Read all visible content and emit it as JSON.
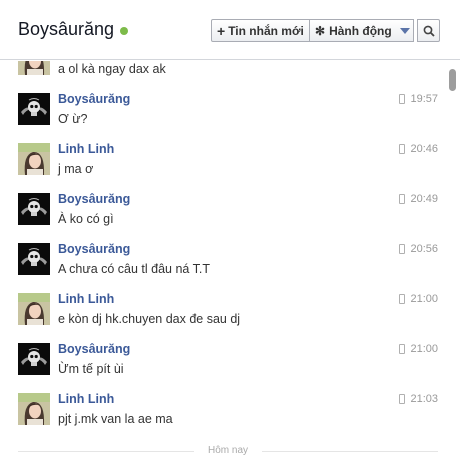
{
  "header": {
    "title": "Boysâurăng",
    "online_color": "#7dbb4a",
    "new_message_label": "Tin nhắn mới",
    "actions_label": "Hành động",
    "search_icon": "search-icon"
  },
  "messages": [
    {
      "sender": "",
      "text": "a ol kà ngay dax ak",
      "time": "",
      "avatar": "girl"
    },
    {
      "sender": "Boysâurăng",
      "text": "Ơ ừ?",
      "time": "19:57",
      "avatar": "skull"
    },
    {
      "sender": "Linh Linh",
      "text": "j ma ơ",
      "time": "20:46",
      "avatar": "girl"
    },
    {
      "sender": "Boysâurăng",
      "text": "À ko có gì",
      "time": "20:49",
      "avatar": "skull"
    },
    {
      "sender": "Boysâurăng",
      "text": "A chưa có câu tl đâu ná T.T",
      "time": "20:56",
      "avatar": "skull"
    },
    {
      "sender": "Linh Linh",
      "text": "e kòn dj hk.chuyen dax đe sau dj",
      "time": "21:00",
      "avatar": "girl"
    },
    {
      "sender": "Boysâurăng",
      "text": "Ừm tế pít ùi",
      "time": "21:00",
      "avatar": "skull"
    },
    {
      "sender": "Linh Linh",
      "text": "pjt j.mk van la ae ma",
      "time": "21:03",
      "avatar": "girl"
    }
  ],
  "separator": {
    "label": "Hôm nay"
  }
}
